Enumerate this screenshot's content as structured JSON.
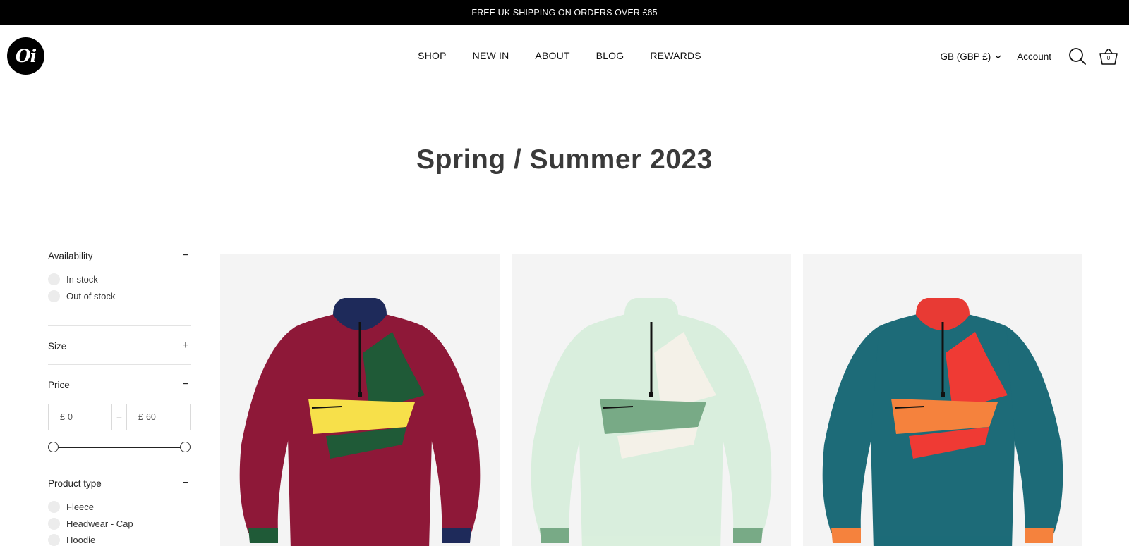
{
  "announcement": "FREE UK SHIPPING ON ORDERS OVER £65",
  "brand": {
    "logo_text": "Oi"
  },
  "nav": [
    {
      "label": "SHOP"
    },
    {
      "label": "NEW IN"
    },
    {
      "label": "ABOUT"
    },
    {
      "label": "BLOG"
    },
    {
      "label": "REWARDS"
    }
  ],
  "header": {
    "currency": "GB (GBP £)",
    "account": "Account",
    "cart_count": "0",
    "icons": {
      "search": "search-icon",
      "cart": "basket-icon",
      "currency": "chevron-down-icon"
    }
  },
  "page_title": "Spring / Summer 2023",
  "filters": {
    "availability": {
      "label": "Availability",
      "toggle": "−",
      "options": [
        {
          "label": "In stock"
        },
        {
          "label": "Out of stock"
        }
      ]
    },
    "size": {
      "label": "Size",
      "toggle": "+"
    },
    "price": {
      "label": "Price",
      "toggle": "−",
      "currency_symbol": "£",
      "min_value": "0",
      "max_value": "60",
      "separator": "–",
      "range_low_fraction": 0,
      "range_high_fraction": 1
    },
    "product_type": {
      "label": "Product type",
      "toggle": "−",
      "options": [
        {
          "label": "Fleece"
        },
        {
          "label": "Headwear - Cap"
        },
        {
          "label": "Hoodie"
        }
      ]
    }
  },
  "products": [
    {
      "image": "fleece-burgundy",
      "colors": {
        "body": "#8e1838",
        "collar": "#1e2a5a",
        "panel_a": "#1f5a37",
        "panel_b": "#f7e04a",
        "panel_c": "#1f5a37",
        "cuff": "#1f5a37",
        "cuff2": "#1e2a5a"
      }
    },
    {
      "image": "fleece-mint",
      "colors": {
        "body": "#d9eedd",
        "collar": "#d9eedd",
        "panel_a": "#f4f1e8",
        "panel_b": "#78aa86",
        "panel_c": "#f4f1e8",
        "cuff": "#78aa86",
        "cuff2": "#78aa86"
      }
    },
    {
      "image": "fleece-teal",
      "colors": {
        "body": "#1d6b78",
        "collar": "#e83a34",
        "panel_a": "#ef3a34",
        "panel_b": "#f5823d",
        "panel_c": "#ef3a34",
        "cuff": "#f5823d",
        "cuff2": "#f5823d"
      }
    }
  ]
}
